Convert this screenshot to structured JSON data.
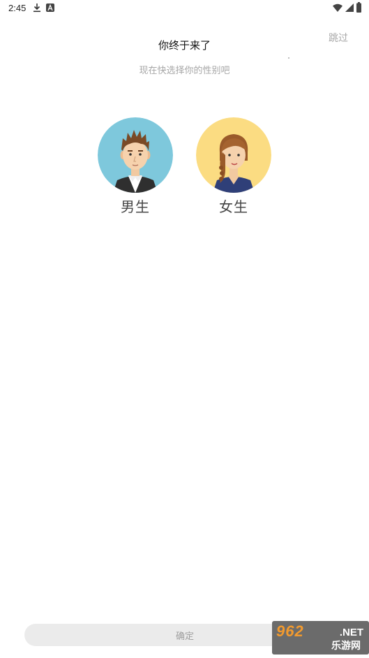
{
  "status_bar": {
    "time": "2:45",
    "icons": [
      "download-icon",
      "a-notification-icon",
      "wifi-icon",
      "signal-icon",
      "battery-icon"
    ]
  },
  "header": {
    "skip_label": "跳过",
    "title": "你终于来了",
    "subtitle": "现在快选择你的性别吧"
  },
  "gender": {
    "options": [
      {
        "label": "男生",
        "avatar": "male-avatar",
        "avatar_bg": "#7ec8dc"
      },
      {
        "label": "女生",
        "avatar": "female-avatar",
        "avatar_bg": "#fbdc82"
      }
    ]
  },
  "footer": {
    "confirm_label": "确定"
  },
  "watermark": {
    "brand": "962",
    "suffix": ".NET",
    "name": "乐游网"
  }
}
